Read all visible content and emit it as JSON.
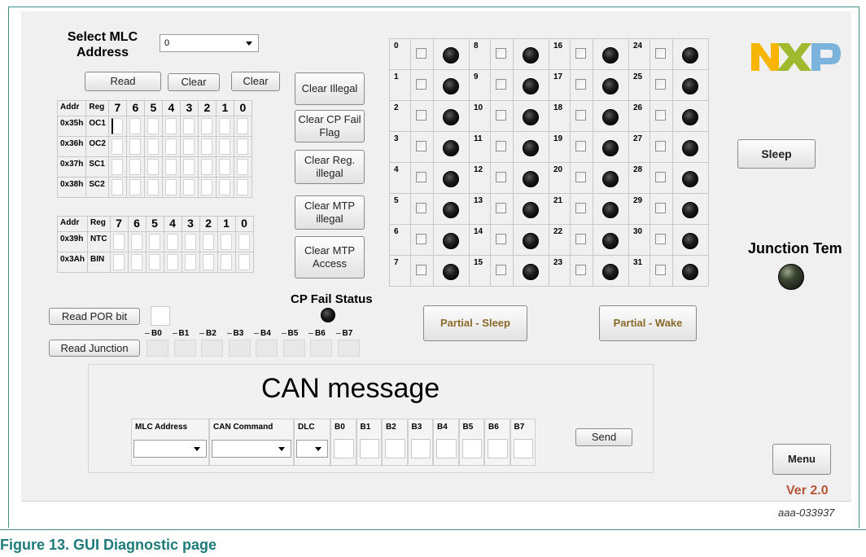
{
  "figure_caption": "Figure 13.  GUI Diagnostic page",
  "figure_id": "aaa-033937",
  "mlc": {
    "select_label": "Select MLC Address",
    "select_value": "0"
  },
  "buttons": {
    "read": "Read",
    "clear1": "Clear",
    "clear2": "Clear",
    "clear_illegal": "Clear Illegal",
    "clear_cp_fail": "Clear CP Fail Flag",
    "clear_reg_illegal": "Clear Reg. illegal",
    "clear_mtp_illegal": "Clear MTP illegal",
    "clear_mtp_access": "Clear MTP Access",
    "read_por": "Read POR bit",
    "read_junction": "Read Junction",
    "partial_sleep": "Partial - Sleep",
    "partial_wake": "Partial - Wake",
    "sleep": "Sleep",
    "send": "Send",
    "menu": "Menu"
  },
  "reg_table1": {
    "headers": [
      "Addr",
      "Reg",
      "7",
      "6",
      "5",
      "4",
      "3",
      "2",
      "1",
      "0"
    ],
    "rows": [
      {
        "addr": "0x35h",
        "reg": "OC1"
      },
      {
        "addr": "0x36h",
        "reg": "OC2"
      },
      {
        "addr": "0x37h",
        "reg": "SC1"
      },
      {
        "addr": "0x38h",
        "reg": "SC2"
      }
    ]
  },
  "reg_table2": {
    "headers": [
      "Addr",
      "Reg",
      "7",
      "6",
      "5",
      "4",
      "3",
      "2",
      "1",
      "0"
    ],
    "rows": [
      {
        "addr": "0x39h",
        "reg": "NTC"
      },
      {
        "addr": "0x3Ah",
        "reg": "BIN"
      }
    ]
  },
  "channels": [
    "0",
    "1",
    "2",
    "3",
    "4",
    "5",
    "6",
    "7",
    "8",
    "9",
    "10",
    "11",
    "12",
    "13",
    "14",
    "15",
    "16",
    "17",
    "18",
    "19",
    "20",
    "21",
    "22",
    "23",
    "24",
    "25",
    "26",
    "27",
    "28",
    "29",
    "30",
    "31"
  ],
  "cp_fail_status": "CP Fail Status",
  "junction_temp": "Junction Tem",
  "junction_bytes": [
    "B0",
    "B1",
    "B2",
    "B3",
    "B4",
    "B5",
    "B6",
    "B7"
  ],
  "can": {
    "title": "CAN message",
    "headers": [
      "MLC Address",
      "CAN Command",
      "DLC",
      "B0",
      "B1",
      "B2",
      "B3",
      "B4",
      "B5",
      "B6",
      "B7"
    ]
  },
  "version": "Ver 2.0",
  "logo_text": "NXP",
  "colors": {
    "version": "#b5553a",
    "partial_text": "#8a6a2a",
    "frame": "#3f8f8a",
    "caption": "#1f7a7a"
  }
}
